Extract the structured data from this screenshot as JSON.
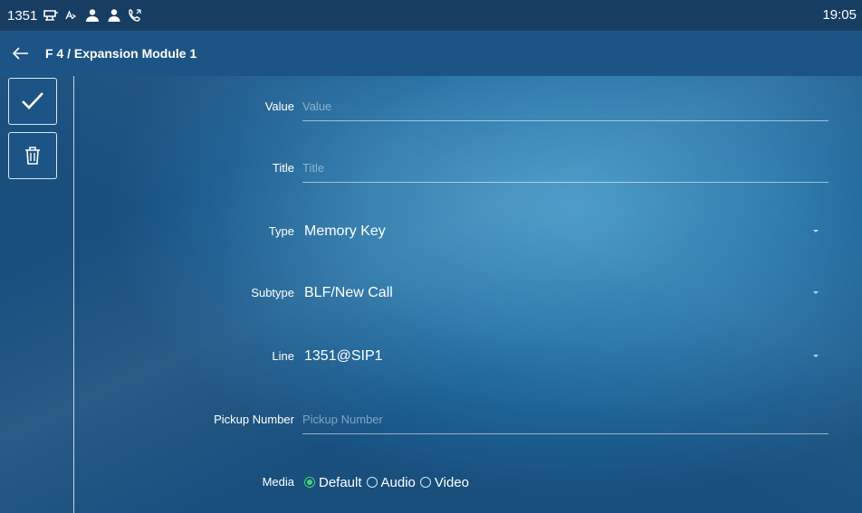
{
  "status_bar": {
    "number": "1351",
    "time": "19:05"
  },
  "header": {
    "title": "F 4 / Expansion Module 1"
  },
  "form": {
    "value": {
      "label": "Value",
      "placeholder": "Value",
      "value": ""
    },
    "title": {
      "label": "Title",
      "placeholder": "Title",
      "value": ""
    },
    "type": {
      "label": "Type",
      "selected": "Memory Key"
    },
    "subtype": {
      "label": "Subtype",
      "selected": "BLF/New Call"
    },
    "line": {
      "label": "Line",
      "selected": "1351@SIP1"
    },
    "pickup": {
      "label": "Pickup Number",
      "placeholder": "Pickup Number",
      "value": ""
    },
    "media": {
      "label": "Media",
      "options": [
        "Default",
        "Audio",
        "Video"
      ],
      "selected": "Default"
    }
  },
  "colors": {
    "radio_accent": "#46d17a",
    "status_bar": "#173d63",
    "title_bar": "#1d5486"
  }
}
